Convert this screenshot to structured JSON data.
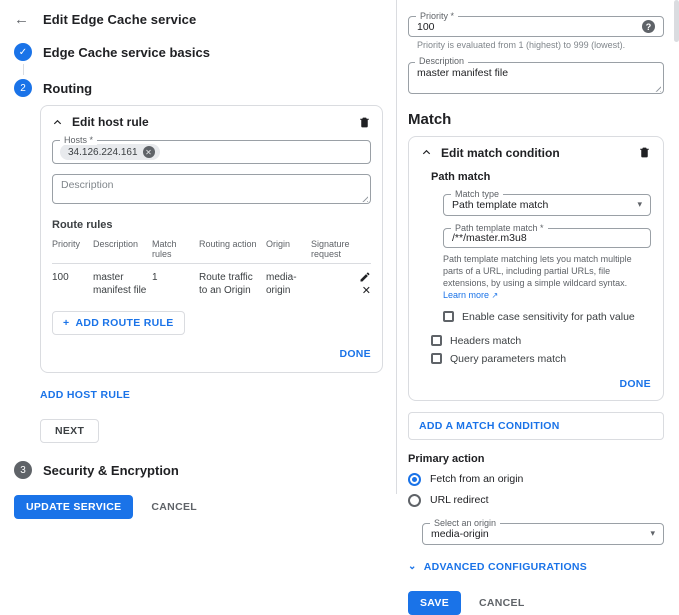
{
  "colors": {
    "accent": "#1a73e8",
    "step_pending": "#5f6368",
    "border": "#dadce0",
    "text": "#202124",
    "secondary_text": "#5f6368"
  },
  "icons": {
    "back": "←",
    "check": "✓",
    "plus": "+",
    "close": "✕",
    "help": "?",
    "caret": "▾",
    "chevron_down": "⌄",
    "external": "↗",
    "chip_remove": "✕"
  },
  "left": {
    "header": {
      "title": "Edit Edge Cache service"
    },
    "steps": [
      {
        "label": "Edge Cache service basics",
        "state": "done"
      },
      {
        "number": "2",
        "label": "Routing",
        "state": "active"
      },
      {
        "number": "3",
        "label": "Security & Encryption",
        "state": "pending"
      }
    ],
    "host_rule": {
      "title": "Edit host rule",
      "hosts_label": "Hosts *",
      "host_chip": "34.126.224.161",
      "description_placeholder": "Description",
      "route_rules_label": "Route rules",
      "table": {
        "headers": [
          "Priority",
          "Description",
          "Match rules",
          "Routing action",
          "Origin",
          "Signature request"
        ],
        "rows": [
          [
            "100",
            "master manifest file",
            "1",
            "Route traffic to an Origin",
            "media-origin",
            ""
          ]
        ]
      },
      "add_route_rule": "ADD ROUTE RULE",
      "done": "DONE"
    },
    "add_host_rule": "ADD HOST RULE",
    "next": "NEXT",
    "update_service": "UPDATE SERVICE",
    "cancel": "CANCEL"
  },
  "right": {
    "priority": {
      "label": "Priority *",
      "value": "100",
      "helper": "Priority is evaluated from 1 (highest) to 999 (lowest)."
    },
    "description": {
      "label": "Description",
      "value": "master manifest file"
    },
    "match_heading": "Match",
    "match_condition": {
      "title": "Edit match condition",
      "path_match_label": "Path match",
      "match_type": {
        "label": "Match type",
        "value": "Path template match"
      },
      "path_template": {
        "label": "Path template match *",
        "value": "/**/master.m3u8"
      },
      "helper": "Path template matching lets you match multiple parts of a URL, including partial URLs, file extensions, by using a simple wildcard syntax. ",
      "learn_more": "Learn more",
      "checkboxes": [
        "Enable case sensitivity for path value",
        "Headers match",
        "Query parameters match"
      ],
      "done": "DONE"
    },
    "add_match_condition": "ADD A MATCH CONDITION",
    "primary_action": {
      "label": "Primary action",
      "options": [
        {
          "label": "Fetch from an origin",
          "selected": true
        },
        {
          "label": "URL redirect",
          "selected": false
        }
      ]
    },
    "origin_select": {
      "label": "Select an origin",
      "value": "media-origin"
    },
    "advanced": "ADVANCED CONFIGURATIONS",
    "save": "SAVE",
    "cancel": "CANCEL"
  }
}
